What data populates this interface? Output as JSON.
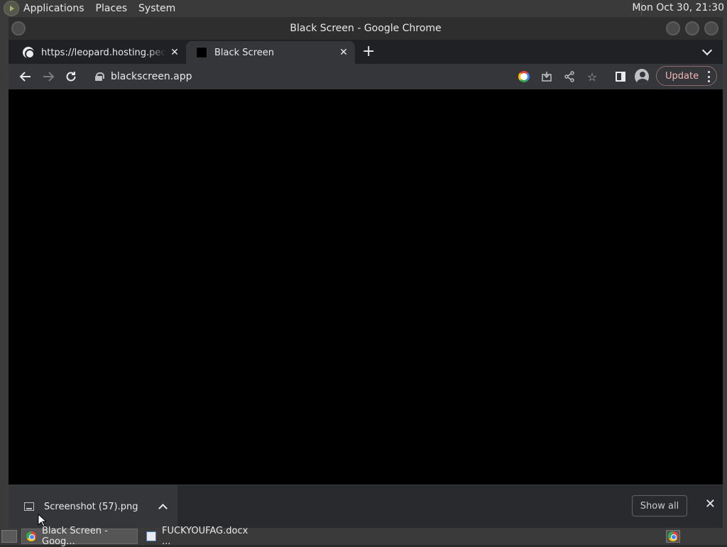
{
  "top_panel": {
    "menus": [
      "Applications",
      "Places",
      "System"
    ],
    "clock": "Mon Oct 30, 21:30"
  },
  "window": {
    "title": "Black Screen - Google Chrome"
  },
  "tabs": [
    {
      "title": "https://leopard.hosting.pecon.us",
      "favicon": "globe-icon",
      "active": false
    },
    {
      "title": "Black Screen",
      "favicon": "black-square-icon",
      "active": true
    }
  ],
  "toolbar": {
    "url": "blackscreen.app",
    "update_label": "Update"
  },
  "download_shelf": {
    "item_name": "Screenshot (57).png",
    "show_all_label": "Show all"
  },
  "taskbar": {
    "tasks": [
      {
        "label": "Black Screen - Goog...",
        "icon": "chrome-icon",
        "active": true
      },
      {
        "label": "FUCKYOUFAG.docx ...",
        "icon": "document-icon",
        "active": false
      }
    ]
  },
  "colors": {
    "page_content": "#000000",
    "chrome_frame": "#202124",
    "toolbar": "#35363a",
    "update_text": "#f2b8b5"
  }
}
